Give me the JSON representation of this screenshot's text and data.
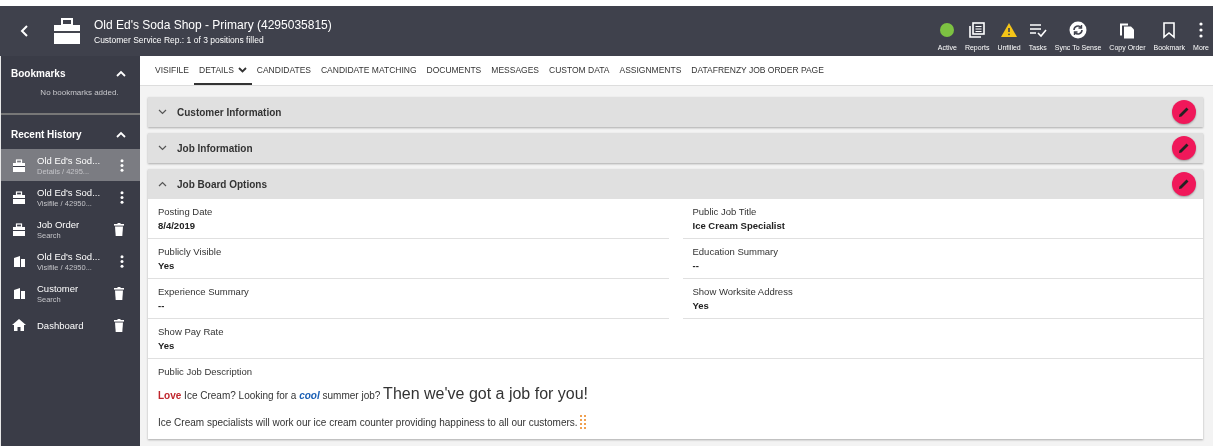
{
  "header": {
    "title": "Old Ed's Soda Shop - Primary (4295035815)",
    "subtitle": "Customer Service Rep.: 1 of 3 positions filled"
  },
  "toolbar": [
    {
      "kind": "status-ok",
      "label": "Active"
    },
    {
      "kind": "reports",
      "label": "Reports"
    },
    {
      "kind": "warning",
      "label": "Unfilled"
    },
    {
      "kind": "tasks",
      "label": "Tasks"
    },
    {
      "kind": "sync",
      "label": "Sync To Sense"
    },
    {
      "kind": "copy",
      "label": "Copy Order"
    },
    {
      "kind": "bookmark",
      "label": "Bookmark"
    },
    {
      "kind": "more",
      "label": "More"
    }
  ],
  "sidebar": {
    "bookmarks": {
      "title": "Bookmarks",
      "expanded": true,
      "empty_text": "No bookmarks added."
    },
    "recent_history": {
      "title": "Recent History",
      "expanded": true,
      "items": [
        {
          "kind": "job-order",
          "title": "Old Ed's Sod...",
          "subtitle": "Details / 4295...",
          "removable": false,
          "selected": true
        },
        {
          "kind": "job-order",
          "title": "Old Ed's Sod...",
          "subtitle": "Visifile / 42950...",
          "removable": false,
          "selected": false
        },
        {
          "kind": "job-order",
          "title": "Job Order",
          "subtitle": "Search",
          "removable": true,
          "selected": false
        },
        {
          "kind": "customer",
          "title": "Old Ed's Sod...",
          "subtitle": "Visifile / 42950...",
          "removable": false,
          "selected": false
        },
        {
          "kind": "customer",
          "title": "Customer",
          "subtitle": "Search",
          "removable": true,
          "selected": false
        },
        {
          "kind": "dashboard",
          "title": "Dashboard",
          "removable": true,
          "selected": false
        }
      ]
    }
  },
  "tabs": [
    {
      "label": "VISIFILE",
      "selected": false,
      "dropdown": false
    },
    {
      "label": "DETAILS",
      "selected": true,
      "dropdown": true
    },
    {
      "label": "CANDIDATES",
      "selected": false,
      "dropdown": false
    },
    {
      "label": "CANDIDATE MATCHING",
      "selected": false,
      "dropdown": false
    },
    {
      "label": "DOCUMENTS",
      "selected": false,
      "dropdown": false
    },
    {
      "label": "MESSAGES",
      "selected": false,
      "dropdown": false
    },
    {
      "label": "CUSTOM DATA",
      "selected": false,
      "dropdown": false
    },
    {
      "label": "ASSIGNMENTS",
      "selected": false,
      "dropdown": false
    },
    {
      "label": "DATAFRENZY JOB ORDER PAGE",
      "selected": false,
      "dropdown": false
    }
  ],
  "sections": [
    {
      "title": "Customer Information",
      "expanded": false
    },
    {
      "title": "Job Information",
      "expanded": false
    },
    {
      "title": "Job Board Options",
      "expanded": true,
      "fields": [
        {
          "label": "Posting Date",
          "value": "8/4/2019"
        },
        {
          "label": "Public Job Title",
          "value": "Ice Cream Specialist"
        },
        {
          "label": "Publicly Visible",
          "value": "Yes"
        },
        {
          "label": "Education Summary",
          "value": "--"
        },
        {
          "label": "Experience Summary",
          "value": "--"
        },
        {
          "label": "Show Worksite Address",
          "value": "Yes"
        },
        {
          "label": "Show Pay Rate",
          "value": "Yes"
        }
      ],
      "description": {
        "label": "Public Job Description",
        "paragraphs": [
          {
            "segments": [
              {
                "kind": "red-bold",
                "text": "Love"
              },
              {
                "kind": "plain",
                "text": " Ice Cream? Looking for a "
              },
              {
                "kind": "blue-italic",
                "text": "cool"
              },
              {
                "kind": "plain",
                "text": " summer job? "
              },
              {
                "kind": "large",
                "text": "Then we've got a job for you!"
              }
            ]
          },
          {
            "segments": [
              {
                "kind": "plain",
                "text": "Ice Cream specialists will work our ice cream counter providing happiness to all our customers."
              }
            ]
          }
        ]
      }
    }
  ]
}
